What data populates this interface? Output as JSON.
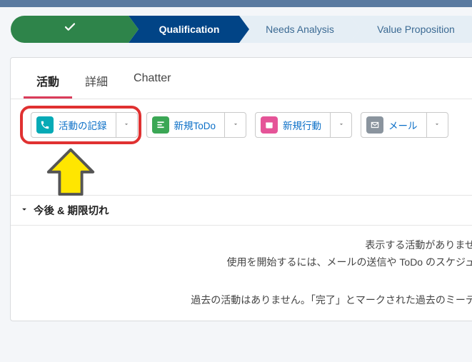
{
  "path": {
    "complete_icon": "check",
    "current": "Qualification",
    "next1": "Needs Analysis",
    "next2": "Value Proposition"
  },
  "tabs": {
    "activity": "活動",
    "detail": "詳細",
    "chatter": "Chatter"
  },
  "actions": {
    "log_call": "活動の記録",
    "new_task": "新規ToDo",
    "new_event": "新規行動",
    "email": "メール"
  },
  "section": {
    "upcoming": "今後 & 期限切れ"
  },
  "messages": {
    "no_activity": "表示する活動がありません。",
    "get_started": "使用を開始するには、メールの送信や ToDo のスケジュール",
    "no_past": "過去の活動はありません。「完了」とマークされた過去のミーティン"
  }
}
